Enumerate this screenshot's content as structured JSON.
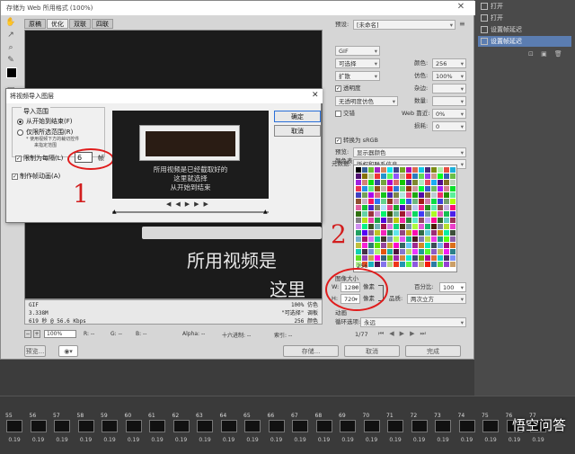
{
  "window_title": "存储为 Web 所用格式 (100%)",
  "tabs": [
    "原稿",
    "优化",
    "双联",
    "四联"
  ],
  "history_panel": {
    "items": [
      {
        "label": "打开",
        "selected": false
      },
      {
        "label": "打开",
        "selected": false
      },
      {
        "label": "设置帧延迟",
        "selected": false
      },
      {
        "label": "设置帧延迟",
        "selected": true
      }
    ]
  },
  "preview": {
    "caption_1": "所用视频是",
    "caption_2": "这里"
  },
  "preview_info": {
    "left": [
      "GIF",
      "3.338M",
      "619 秒 @ 56.6 Kbps"
    ],
    "right": [
      "100% 仿色",
      "\"可选择\" 调板",
      "256 颜色"
    ]
  },
  "bottom_bar": {
    "zoom": "100%",
    "r": "R: --",
    "g": "G: --",
    "b": "B: --",
    "alpha": "Alpha: --",
    "hex": "十六进制: --",
    "index": "索引: --",
    "preview_button": "预览...",
    "save_button": "存储...",
    "cancel_button": "取消",
    "done_button": "完成"
  },
  "settings": {
    "preset_label": "预设:",
    "preset_value": "[未命名]",
    "format": "GIF",
    "reduction": "可选择",
    "colors_label": "颜色:",
    "colors_value": "256",
    "dither": "扩散",
    "dither_label": "仿色:",
    "dither_value": "100%",
    "transparency_label": "透明度",
    "matte_label": "杂边:",
    "trans_dither": "无透明度仿色",
    "amount_label": "数量:",
    "interlaced_label": "交错",
    "web_snap_label": "Web 靠近:",
    "web_snap_value": "0%",
    "lossy_label": "损耗:",
    "lossy_value": "0",
    "convert_srgb_label": "转换为 sRGB",
    "preview_label": "预览:",
    "preview_value": "显示器颜色",
    "metadata_label": "元数据:",
    "metadata_value": "版权和联系信息",
    "color_table_label": "颜色表",
    "palette_count": "256",
    "image_size_label": "图像大小",
    "width_label": "W:",
    "width_value": "1280",
    "height_label": "H:",
    "height_value": "720",
    "unit": "像素",
    "percent_label": "百分比:",
    "percent_value": "100",
    "quality_label": "品质:",
    "quality_value": "两次立方",
    "animation_label": "动画",
    "loop_label": "循环选项:",
    "loop_value": "永远",
    "frame_counter": "1/77"
  },
  "import_dialog": {
    "title": "将视频导入图层",
    "section_label": "导入范围",
    "option_all": "从开始到结束(F)",
    "option_selected": "仅限所选范围(R)",
    "option_note_1": "* 使用视频下方的裁切控件",
    "option_note_2": "来指定范围",
    "limit_label": "限制为每隔(L)",
    "limit_value": "6",
    "limit_unit": "帧",
    "make_anim_label": "制作帧动画(A)",
    "ok_button": "确定",
    "cancel_button": "取消",
    "thumb_text_1": "所用视频是已经截取好的",
    "thumb_text_2": "这里就选择",
    "thumb_text_3": "从开始到结束"
  },
  "annotations": {
    "one": "1",
    "two": "2"
  },
  "timeline": {
    "frames": [
      {
        "num": "55",
        "time": "0.19"
      },
      {
        "num": "56",
        "time": "0.19"
      },
      {
        "num": "57",
        "time": "0.19"
      },
      {
        "num": "58",
        "time": "0.19"
      },
      {
        "num": "59",
        "time": "0.19"
      },
      {
        "num": "60",
        "time": "0.19"
      },
      {
        "num": "61",
        "time": "0.19"
      },
      {
        "num": "62",
        "time": "0.19"
      },
      {
        "num": "63",
        "time": "0.19"
      },
      {
        "num": "64",
        "time": "0.19"
      },
      {
        "num": "65",
        "time": "0.19"
      },
      {
        "num": "66",
        "time": "0.19"
      },
      {
        "num": "67",
        "time": "0.19"
      },
      {
        "num": "68",
        "time": "0.19"
      },
      {
        "num": "69",
        "time": "0.19"
      },
      {
        "num": "70",
        "time": "0.19"
      },
      {
        "num": "71",
        "time": "0.19"
      },
      {
        "num": "72",
        "time": "0.19"
      },
      {
        "num": "73",
        "time": "0.19"
      },
      {
        "num": "74",
        "time": "0.19"
      },
      {
        "num": "75",
        "time": "0.19"
      },
      {
        "num": "76",
        "time": "0.19"
      },
      {
        "num": "77",
        "time": "0.19"
      }
    ]
  },
  "watermark": "悟空问答",
  "colors": {
    "annotation_red": "#e01c1c",
    "selected_blue": "#5b7db1"
  }
}
